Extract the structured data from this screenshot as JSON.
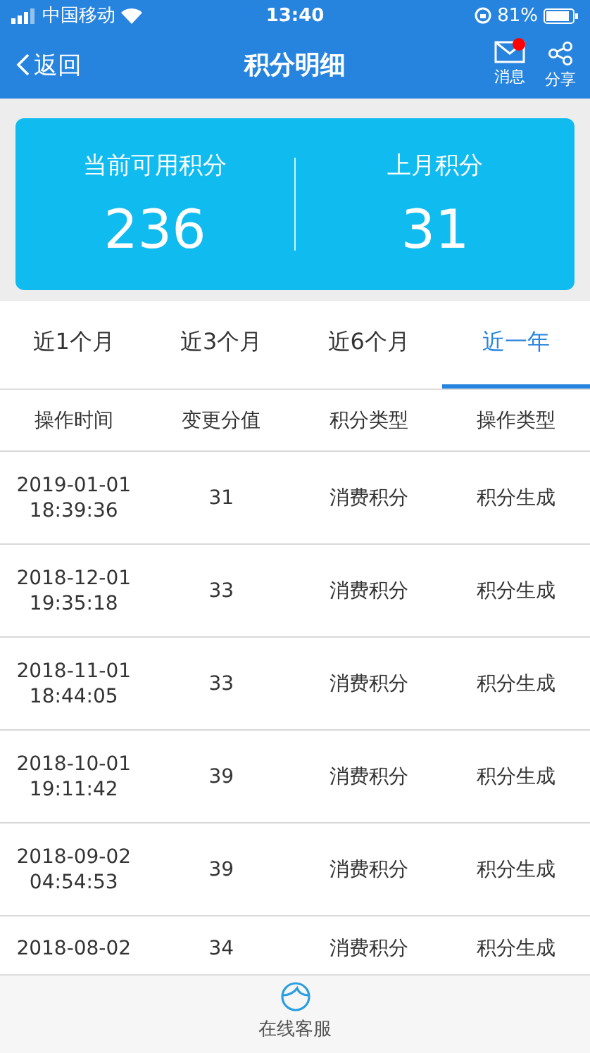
{
  "status_bar": {
    "carrier": "中国移动",
    "time": "13:40",
    "battery": "81%"
  },
  "nav": {
    "back": "返回",
    "title": "积分明细",
    "actions": [
      {
        "label": "消息",
        "kind": "mail",
        "badge": true
      },
      {
        "label": "分享",
        "kind": "share",
        "badge": false
      }
    ]
  },
  "summary": [
    {
      "label": "当前可用积分",
      "value": "236"
    },
    {
      "label": "上月积分",
      "value": "31"
    }
  ],
  "tabs": [
    {
      "label": "近1个月",
      "selected": false
    },
    {
      "label": "近3个月",
      "selected": false
    },
    {
      "label": "近6个月",
      "selected": false
    },
    {
      "label": "近一年",
      "selected": true
    }
  ],
  "table": {
    "columns": [
      "操作时间",
      "变更分值",
      "积分类型",
      "操作类型"
    ],
    "rows": [
      {
        "time": [
          "2019-01-01",
          "18:39:36"
        ],
        "points": "31",
        "type": "消费积分",
        "op": "积分生成"
      },
      {
        "time": [
          "2018-12-01",
          "19:35:18"
        ],
        "points": "33",
        "type": "消费积分",
        "op": "积分生成"
      },
      {
        "time": [
          "2018-11-01",
          "18:44:05"
        ],
        "points": "33",
        "type": "消费积分",
        "op": "积分生成"
      },
      {
        "time": [
          "2018-10-01",
          "19:11:42"
        ],
        "points": "39",
        "type": "消费积分",
        "op": "积分生成"
      },
      {
        "time": [
          "2018-09-02",
          "04:54:53"
        ],
        "points": "39",
        "type": "消费积分",
        "op": "积分生成"
      },
      {
        "time": [
          "2018-08-02"
        ],
        "points": "34",
        "type": "消费积分",
        "op": "积分生成"
      }
    ]
  },
  "footer": {
    "label": "在线客服"
  }
}
